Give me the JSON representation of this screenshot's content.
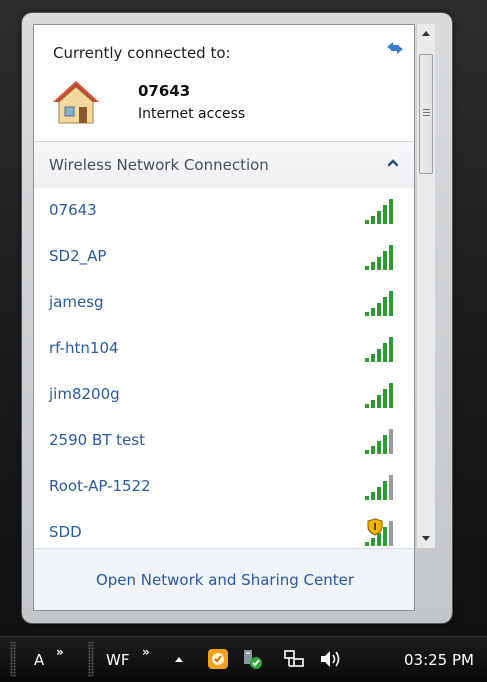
{
  "connected": {
    "title": "Currently connected to:",
    "network_name": "07643",
    "status": "Internet access"
  },
  "section": {
    "title": "Wireless Network Connection"
  },
  "networks": [
    {
      "name": "07643",
      "signal_bars": 5,
      "secured_shield": false
    },
    {
      "name": "SD2_AP",
      "signal_bars": 5,
      "secured_shield": false
    },
    {
      "name": "jamesg",
      "signal_bars": 5,
      "secured_shield": false
    },
    {
      "name": "rf-htn104",
      "signal_bars": 5,
      "secured_shield": false
    },
    {
      "name": "jim8200g",
      "signal_bars": 5,
      "secured_shield": false
    },
    {
      "name": "2590 BT test",
      "signal_bars": 4,
      "secured_shield": false
    },
    {
      "name": "Root-AP-1522",
      "signal_bars": 4,
      "secured_shield": false
    },
    {
      "name": "SDD",
      "signal_bars": 4,
      "secured_shield": true
    }
  ],
  "footer": {
    "link": "Open Network and Sharing Center"
  },
  "taskbar": {
    "toolbar_a": "A",
    "toolbar_wf": "WF",
    "overflow_glyph": "»",
    "clock": "03:25 PM"
  },
  "colors": {
    "link_blue": "#2a5aa0",
    "signal_green": "#2e9a32",
    "signal_gray": "#9a9a9a"
  }
}
